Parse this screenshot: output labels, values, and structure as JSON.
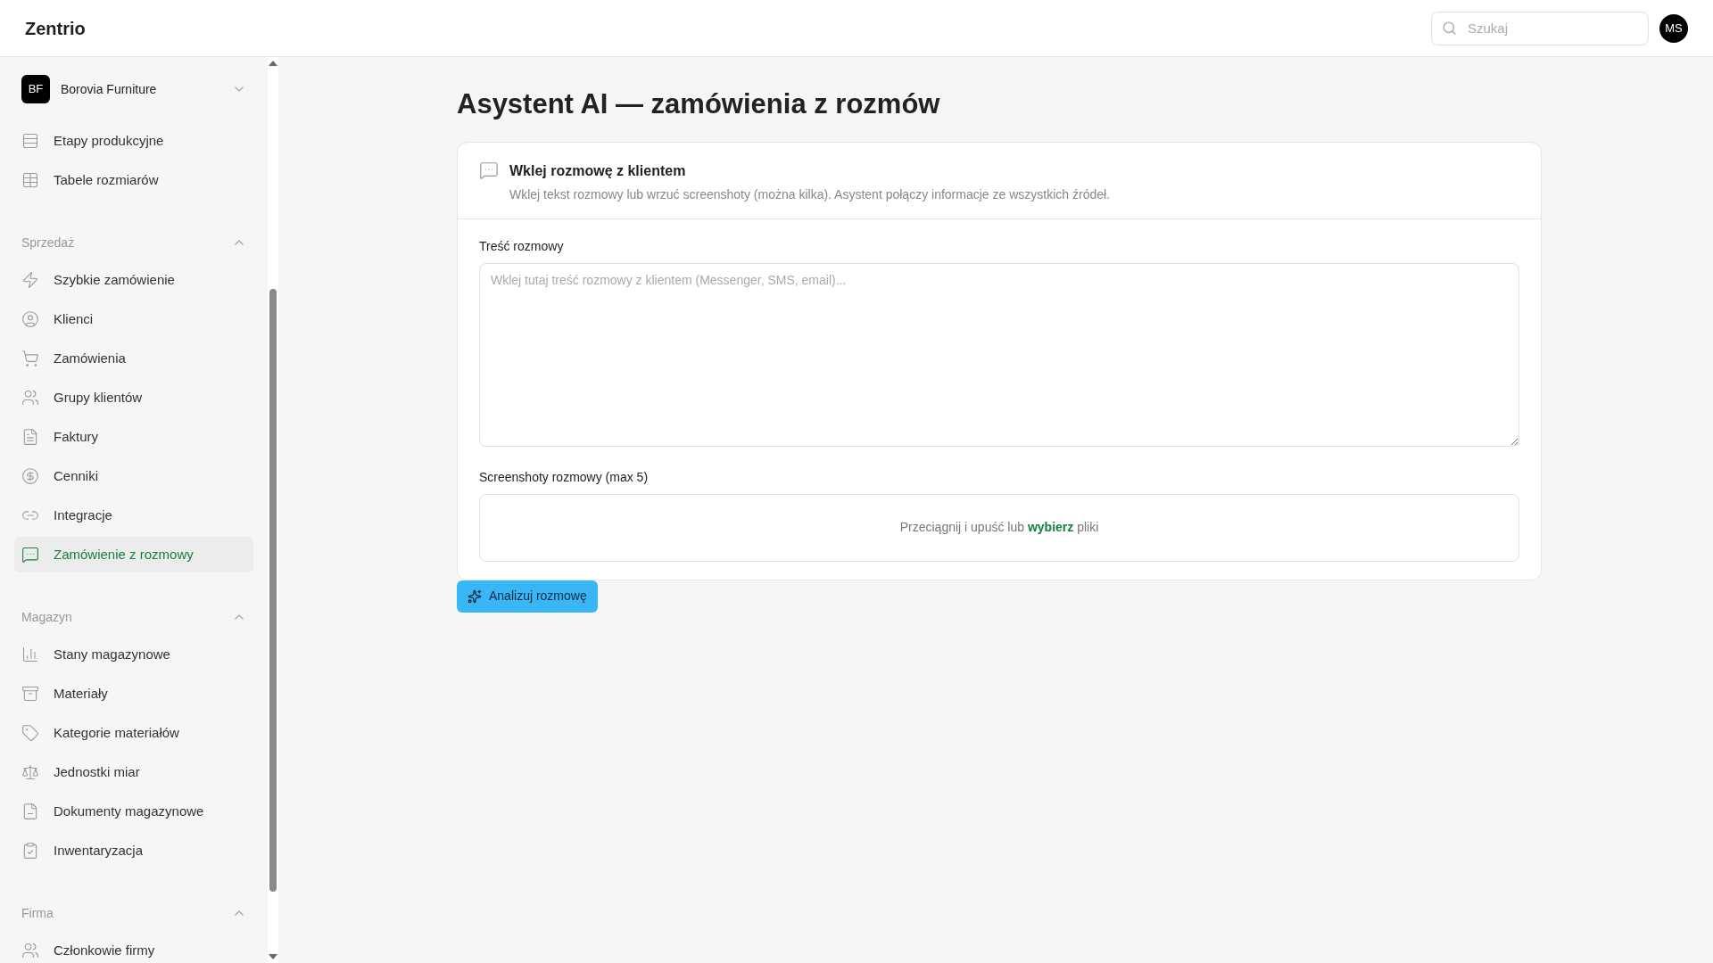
{
  "app": {
    "logo": "Zentrio"
  },
  "search": {
    "placeholder": "Szukaj"
  },
  "user": {
    "initials": "MS"
  },
  "sidebar": {
    "company": {
      "initials": "BF",
      "name": "Borovia Furniture"
    },
    "items": [
      {
        "label": "Etapy produkcyjne",
        "selected": false
      },
      {
        "label": "Tabele rozmiarów",
        "selected": false
      }
    ],
    "groups": [
      {
        "title": "Sprzedaż",
        "expanded": true,
        "items": [
          {
            "label": "Szybkie zamówienie",
            "selected": false
          },
          {
            "label": "Klienci",
            "selected": false
          },
          {
            "label": "Zamówienia",
            "selected": false
          },
          {
            "label": "Grupy klientów",
            "selected": false
          },
          {
            "label": "Faktury",
            "selected": false
          },
          {
            "label": "Cenniki",
            "selected": false
          },
          {
            "label": "Integracje",
            "selected": false
          },
          {
            "label": "Zamówienie z rozmowy",
            "selected": true
          }
        ]
      },
      {
        "title": "Magazyn",
        "expanded": true,
        "items": [
          {
            "label": "Stany magazynowe",
            "selected": false
          },
          {
            "label": "Materiały",
            "selected": false
          },
          {
            "label": "Kategorie materiałów",
            "selected": false
          },
          {
            "label": "Jednostki miar",
            "selected": false
          },
          {
            "label": "Dokumenty magazynowe",
            "selected": false
          },
          {
            "label": "Inwentaryzacja",
            "selected": false
          }
        ]
      },
      {
        "title": "Firma",
        "expanded": true,
        "items": [
          {
            "label": "Członkowie firmy",
            "selected": false
          }
        ]
      }
    ]
  },
  "page": {
    "title": "Asystent AI — zamówienia z rozmów",
    "card": {
      "title": "Wklej rozmowę z klientem",
      "description": "Wklej tekst rozmowy lub wrzuć screenshoty (można kilka). Asystent połączy informacje ze wszystkich źródeł.",
      "text_label": "Treść rozmowy",
      "text_placeholder": "Wklej tutaj treść rozmowy z klientem (Messenger, SMS, email)...",
      "upload_label": "Screenshoty rozmowy (max 5)",
      "upload_text_before": "Przeciągnij i upuść lub",
      "upload_link": "wybierz",
      "upload_text_after": "pliki"
    },
    "button": "Analizuj rozmowę"
  }
}
